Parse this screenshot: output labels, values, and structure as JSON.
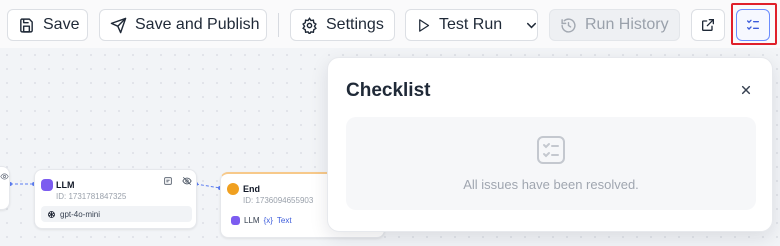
{
  "toolbar": {
    "save_label": "Save",
    "save_publish_label": "Save and Publish",
    "settings_label": "Settings",
    "test_run_label": "Test Run",
    "run_history_label": "Run History"
  },
  "nodes": {
    "llm": {
      "title": "LLM",
      "id": "ID: 1731781847325",
      "model": "gpt-4o-mini"
    },
    "end": {
      "title": "End",
      "id": "ID: 1736094655903",
      "output_source": "LLM",
      "output_var": "{x}",
      "output_type": "Text"
    }
  },
  "checklist": {
    "title": "Checklist",
    "empty_message": "All issues have been resolved."
  },
  "colors": {
    "accent": "#3b5bdb",
    "highlight": "#e0202a",
    "llm_badge": "#7c5cf0",
    "end_badge": "#f0a020"
  }
}
